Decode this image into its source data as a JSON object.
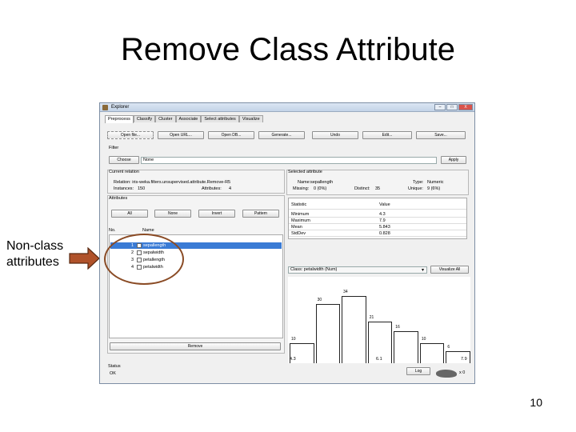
{
  "slide": {
    "title": "Remove Class Attribute",
    "page_number": "10",
    "callout": "Non-class attributes"
  },
  "window": {
    "title": "Explorer",
    "controls": [
      "–",
      "□",
      "X"
    ]
  },
  "tabs": [
    "Preprocess",
    "Classify",
    "Cluster",
    "Associate",
    "Select attributes",
    "Visualize"
  ],
  "toolbar": [
    "Open file...",
    "Open URL...",
    "Open DB...",
    "Generate...",
    "Undo",
    "Edit...",
    "Save..."
  ],
  "filter": {
    "label": "Filter",
    "choose": "Choose",
    "value": "None",
    "apply": "Apply"
  },
  "current_relation": {
    "label": "Current relation",
    "relation_line": "Relation: iris-weka.filters.unsupervised.attribute.Remove-R5",
    "instances_label": "Instances:",
    "instances": "150",
    "attributes_label": "Attributes:",
    "attributes": "4"
  },
  "attributes_panel": {
    "label": "Attributes",
    "buttons": [
      "All",
      "None",
      "Invert",
      "Pattern"
    ],
    "col_no": "No.",
    "col_name": "Name",
    "rows": [
      {
        "no": "1",
        "name": "sepallength",
        "selected": true
      },
      {
        "no": "2",
        "name": "sepalwidth",
        "selected": false
      },
      {
        "no": "3",
        "name": "petallength",
        "selected": false
      },
      {
        "no": "4",
        "name": "petalwidth",
        "selected": false
      }
    ],
    "remove": "Remove"
  },
  "selected_attribute": {
    "label": "Selected attribute",
    "name_label": "Name:",
    "name": "sepallength",
    "type_label": "Type:",
    "type": "Numeric",
    "missing_label": "Missing:",
    "missing": "0 (0%)",
    "distinct_label": "Distinct:",
    "distinct": "35",
    "unique_label": "Unique:",
    "unique": "9 (6%)",
    "table_header": [
      "Statistic",
      "Value"
    ],
    "stats": [
      {
        "k": "Minimum",
        "v": "4.3"
      },
      {
        "k": "Maximum",
        "v": "7.9"
      },
      {
        "k": "Mean",
        "v": "5.843"
      },
      {
        "k": "StdDev",
        "v": "0.828"
      }
    ]
  },
  "class_select": {
    "value": "Class: petalwidth (Num)",
    "visualize_all": "Visualize All"
  },
  "histogram": {
    "bar_labels": [
      "10",
      "30",
      "34",
      "21",
      "16",
      "10",
      "6"
    ],
    "bar_heights": [
      10,
      30,
      34,
      21,
      16,
      10,
      6
    ],
    "x_min": "4.3",
    "x_mid": "6.1",
    "x_max": "7.9"
  },
  "status": {
    "label": "Status",
    "value": "OK",
    "log": "Log",
    "x0": "x 0"
  }
}
